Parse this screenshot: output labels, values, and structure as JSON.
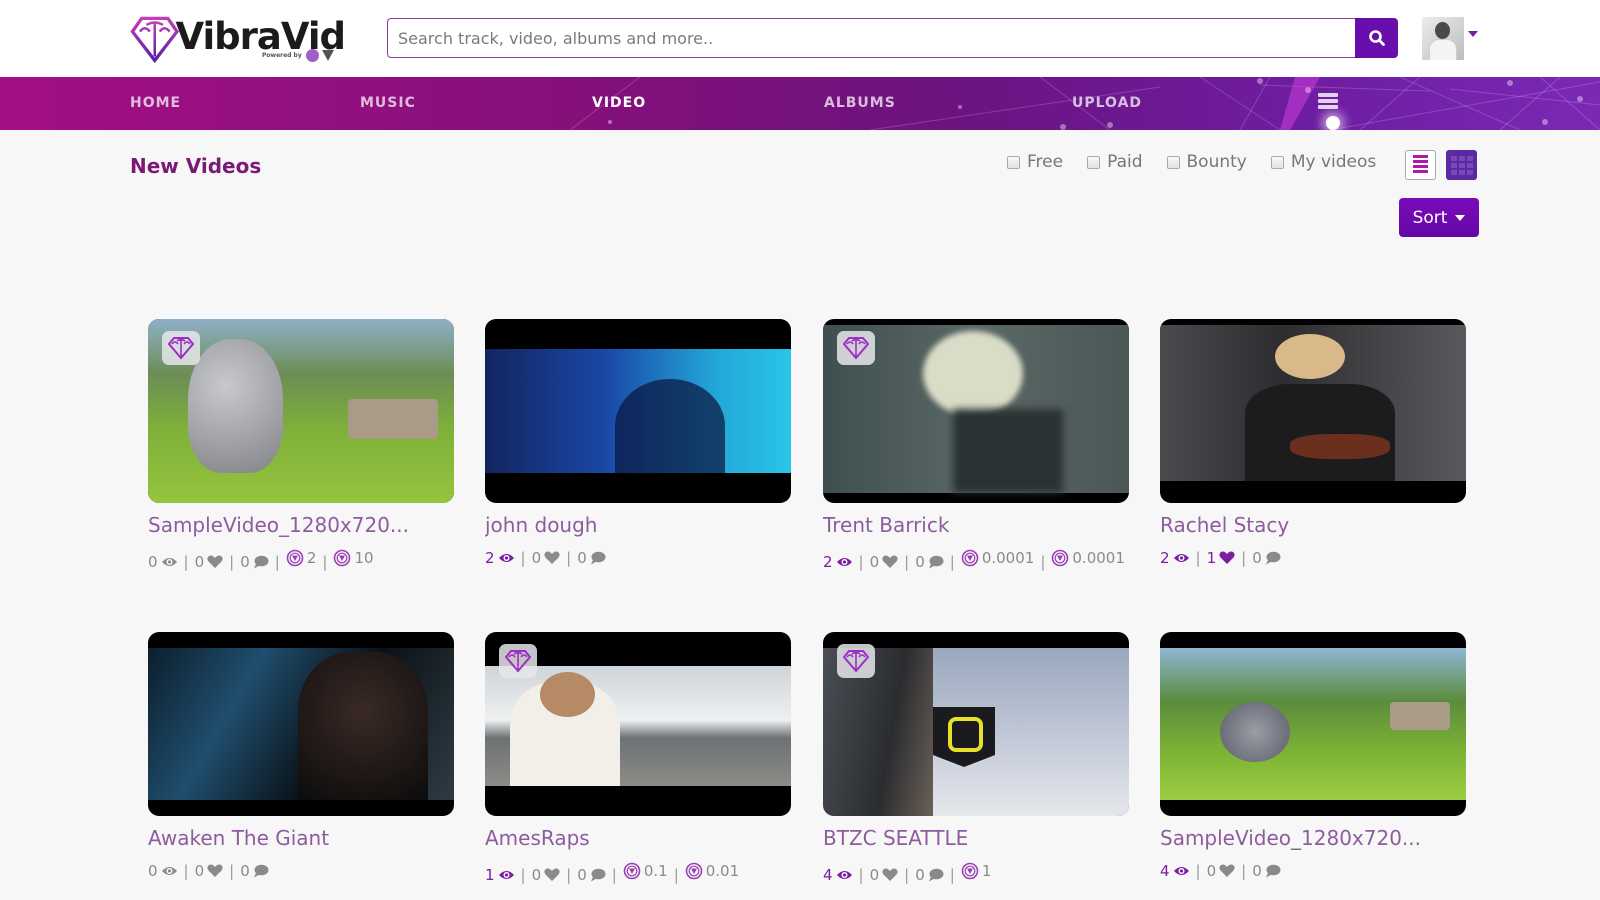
{
  "brand": {
    "name": "VibraVid",
    "powered_by": "Powered by",
    "accent": "#7b1fa2",
    "nav_gradient": [
      "#a20f85",
      "#7b29b5"
    ]
  },
  "header": {
    "search_placeholder": "Search track, video, albums and more..",
    "search_value": "",
    "search_icon": "search-icon",
    "avatar_icon": "user-avatar",
    "avatar_menu_icon": "caret-down-icon"
  },
  "nav": {
    "items": [
      {
        "label": "HOME",
        "active": false
      },
      {
        "label": "MUSIC",
        "active": false
      },
      {
        "label": "VIDEO",
        "active": true
      },
      {
        "label": "ALBUMS",
        "active": false
      },
      {
        "label": "UPLOAD",
        "active": false
      }
    ],
    "menu_icon": "hamburger-icon"
  },
  "toolbar": {
    "title": "New Videos",
    "filters": [
      {
        "label": "Free",
        "checked": false
      },
      {
        "label": "Paid",
        "checked": false
      },
      {
        "label": "Bounty",
        "checked": false
      },
      {
        "label": "My videos",
        "checked": false
      }
    ],
    "view_list_icon": "list-view-icon",
    "view_grid_icon": "grid-view-icon",
    "view_mode": "grid",
    "sort_label": "Sort"
  },
  "videos": [
    {
      "title": "SampleVideo_1280x720...",
      "views": "0",
      "likes": "0",
      "comments": "0",
      "coin_values": [
        "2",
        "10"
      ],
      "premium_badge": true,
      "scene": "cartoon"
    },
    {
      "title": "john dough",
      "views": "2",
      "likes": "0",
      "comments": "0",
      "coin_values": [],
      "premium_badge": false,
      "scene": "blue"
    },
    {
      "title": "Trent Barrick",
      "views": "2",
      "likes": "0",
      "comments": "0",
      "coin_values": [
        "0.0001",
        "0.0001"
      ],
      "premium_badge": true,
      "scene": "blur"
    },
    {
      "title": "Rachel Stacy",
      "views": "2",
      "likes": "1",
      "comments": "0",
      "coin_values": [],
      "premium_badge": false,
      "scene": "studio"
    },
    {
      "title": "Awaken The Giant",
      "views": "0",
      "likes": "0",
      "comments": "0",
      "coin_values": [],
      "premium_badge": false,
      "scene": "dark"
    },
    {
      "title": "AmesRaps",
      "views": "1",
      "likes": "0",
      "comments": "0",
      "coin_values": [
        "0.1",
        "0.01"
      ],
      "premium_badge": true,
      "scene": "bridge"
    },
    {
      "title": "BTZC SEATTLE",
      "views": "4",
      "likes": "0",
      "comments": "0",
      "coin_values": [
        "1"
      ],
      "premium_badge": true,
      "scene": "sign"
    },
    {
      "title": "SampleVideo_1280x720...",
      "views": "4",
      "likes": "0",
      "comments": "0",
      "coin_values": [],
      "premium_badge": false,
      "scene": "cartoon2"
    }
  ],
  "icons": {
    "views": "eye-icon",
    "likes": "heart-icon",
    "comments": "comment-icon",
    "coin": "coin-icon",
    "premium": "diamond-icon"
  }
}
